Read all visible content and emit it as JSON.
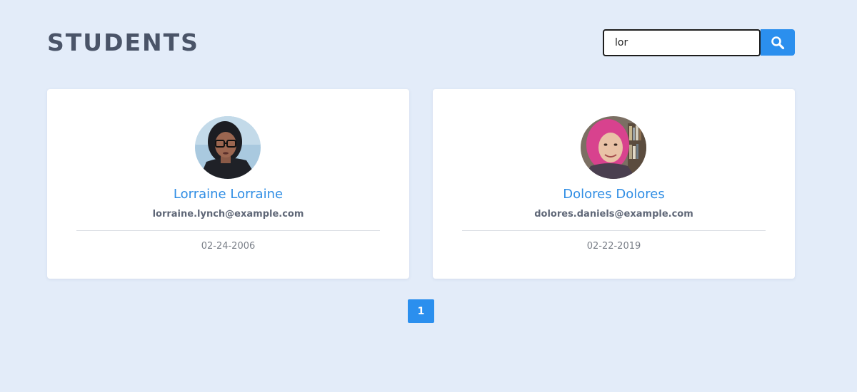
{
  "header": {
    "title": "STUDENTS"
  },
  "search": {
    "value": "lor",
    "icon": "search-icon"
  },
  "students": [
    {
      "name": "Lorraine Lorraine",
      "email": "lorraine.lynch@example.com",
      "date": "02-24-2006"
    },
    {
      "name": "Dolores Dolores",
      "email": "dolores.daniels@example.com",
      "date": "02-22-2019"
    }
  ],
  "pagination": {
    "pages": [
      "1"
    ],
    "active": "1"
  },
  "colors": {
    "background": "#e3ecf9",
    "accent": "#2b8fee",
    "name": "#2f8de4",
    "title": "#4a5468"
  }
}
